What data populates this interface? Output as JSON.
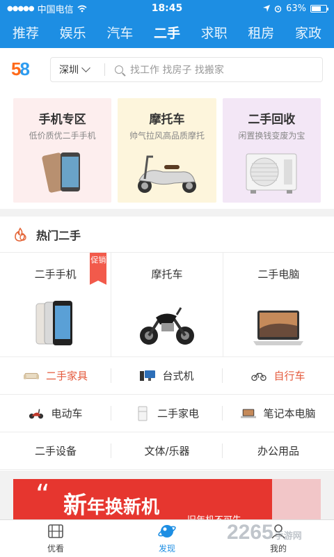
{
  "status": {
    "carrier": "中国电信",
    "time": "18:45",
    "battery": "63%"
  },
  "tabs": [
    {
      "label": "推荐"
    },
    {
      "label": "娱乐"
    },
    {
      "label": "汽车"
    },
    {
      "label": "二手"
    },
    {
      "label": "求职"
    },
    {
      "label": "租房"
    },
    {
      "label": "家政"
    }
  ],
  "active_tab": "二手",
  "logo": {
    "d1": "5",
    "d2": "8"
  },
  "search": {
    "city": "深圳",
    "placeholder": "找工作 找房子 找搬家"
  },
  "featured": [
    {
      "title": "手机专区",
      "subtitle": "低价质优二手手机",
      "color": "#fdeeee"
    },
    {
      "title": "摩托车",
      "subtitle": "帅气拉风高品质摩托",
      "color": "#fdf5dc"
    },
    {
      "title": "二手回收",
      "subtitle": "闲置换钱变废为宝",
      "color": "#f3e7f6"
    }
  ],
  "hot": {
    "title": "热门二手",
    "big": [
      {
        "label": "二手手机",
        "badge": "促销"
      },
      {
        "label": "摩托车"
      },
      {
        "label": "二手电脑"
      }
    ],
    "rows": [
      [
        {
          "label": "二手家具",
          "icon": "sofa-icon"
        },
        {
          "label": "台式机",
          "icon": "desktop-icon"
        },
        {
          "label": "自行车",
          "icon": "bicycle-icon"
        }
      ],
      [
        {
          "label": "电动车",
          "icon": "scooter-icon"
        },
        {
          "label": "二手家电",
          "icon": "fridge-icon"
        },
        {
          "label": "笔记本电脑",
          "icon": "laptop-icon"
        }
      ],
      [
        {
          "label": "二手设备"
        },
        {
          "label": "文体/乐器"
        },
        {
          "label": "办公用品"
        }
      ]
    ]
  },
  "banner": {
    "quote": "“",
    "first": "新",
    "rest": "年换新机",
    "sub": "旧年机不可失"
  },
  "bottom": [
    {
      "label": "优看"
    },
    {
      "label": "发现"
    },
    {
      "label": "我的"
    }
  ],
  "watermark": {
    "num": "2265",
    "site": "手游网"
  }
}
